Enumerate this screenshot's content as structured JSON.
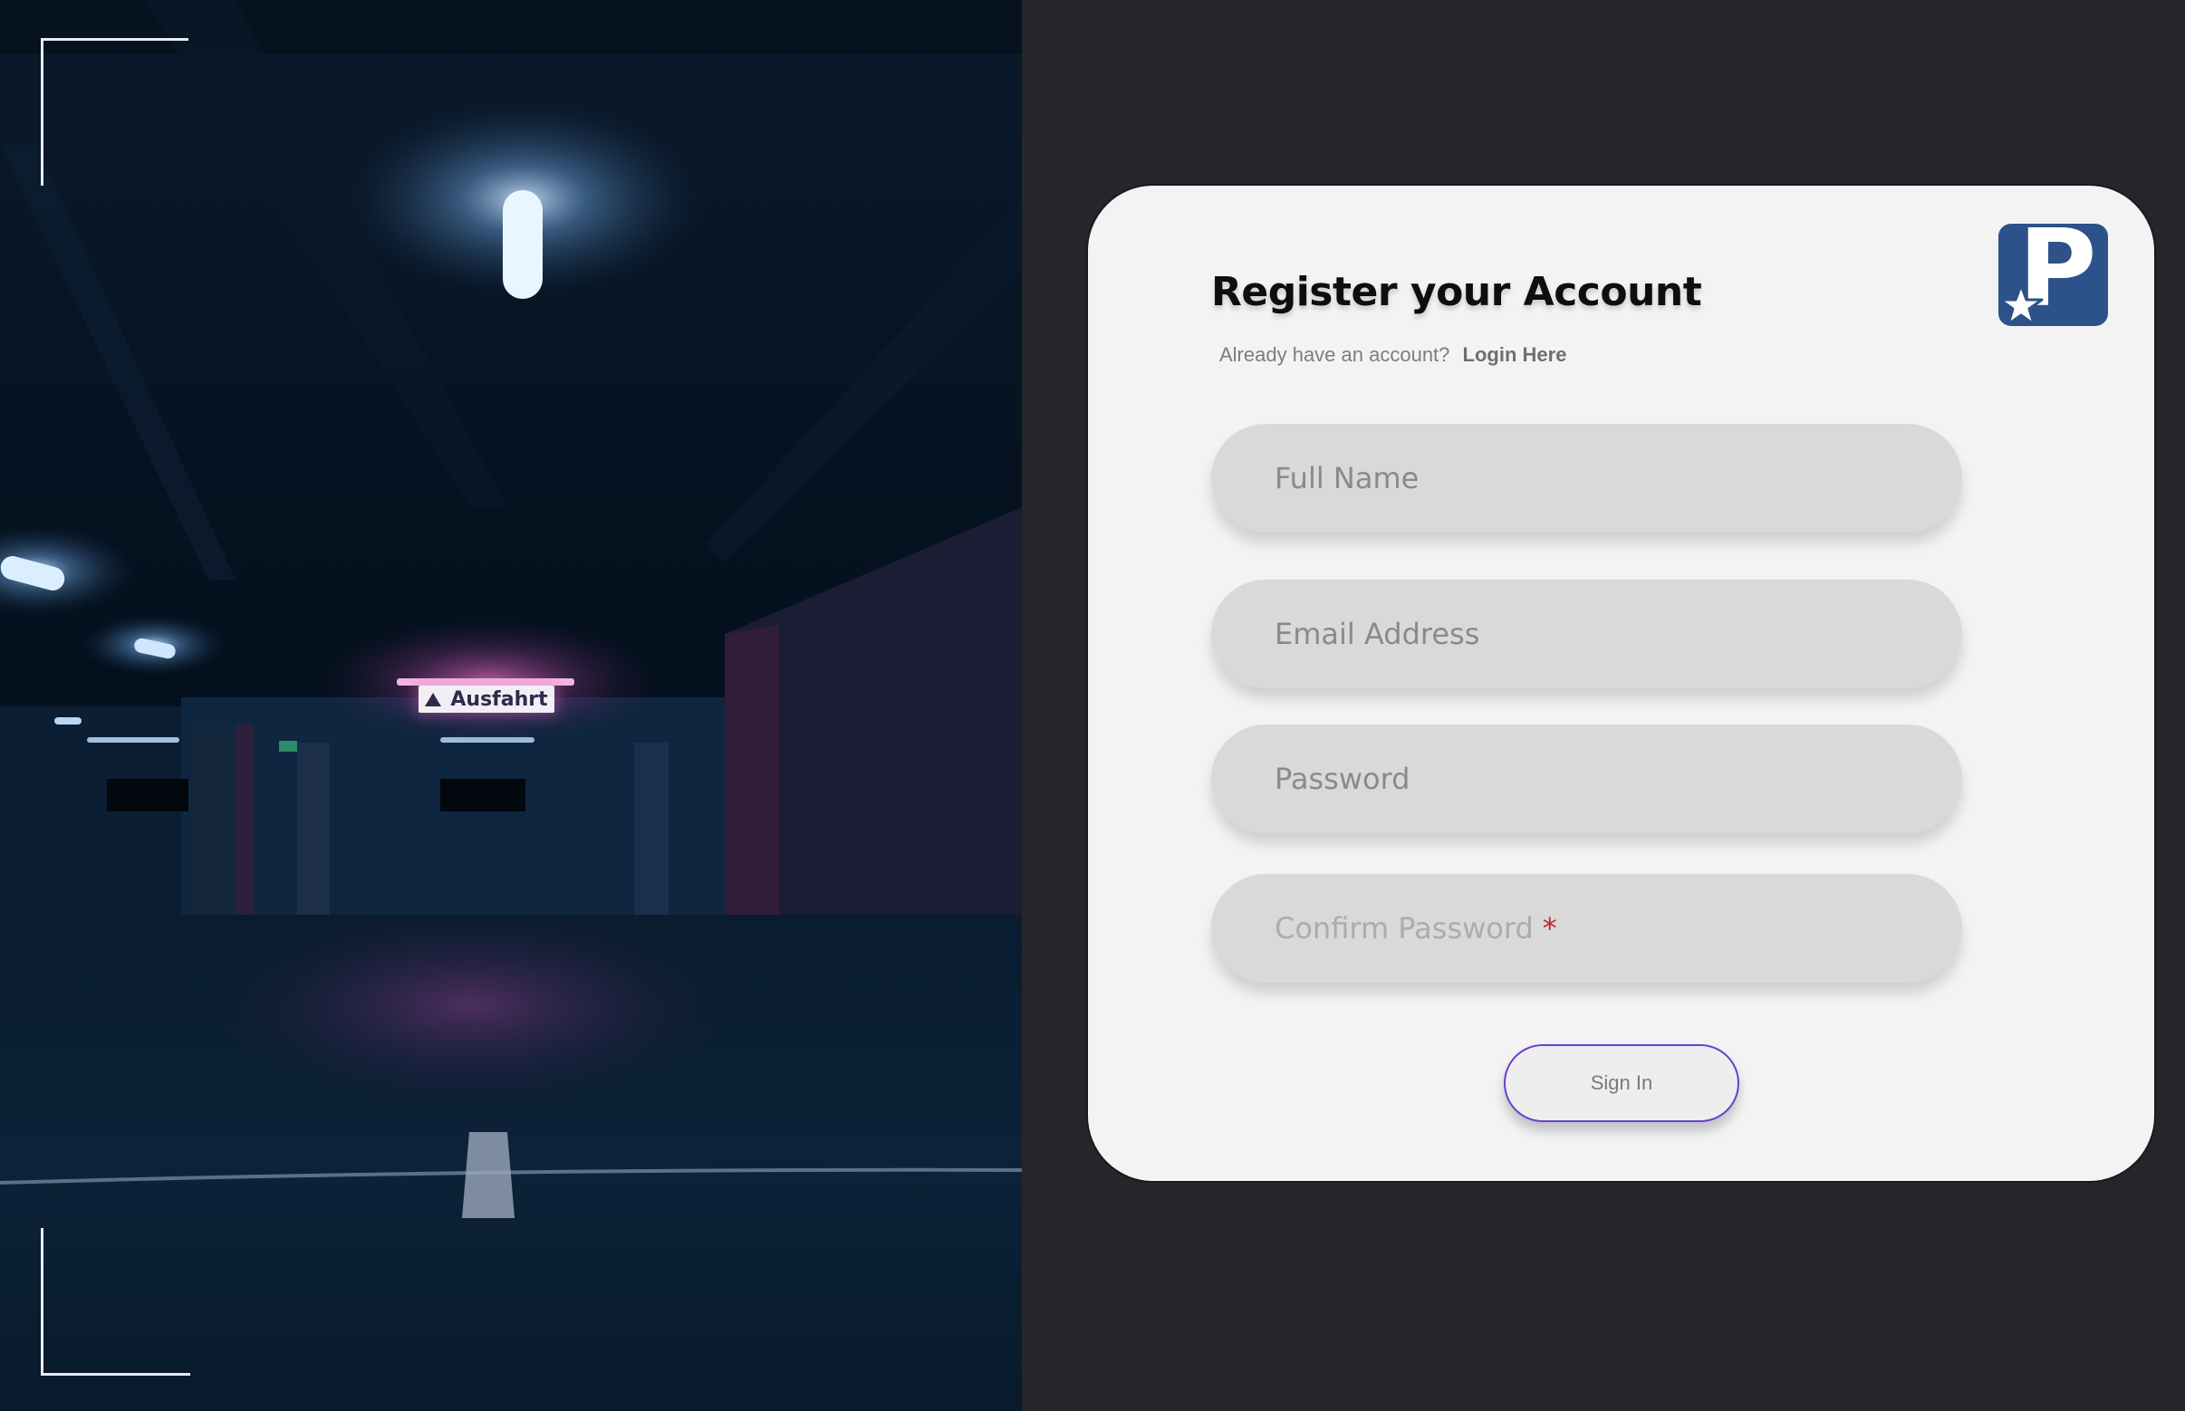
{
  "photo": {
    "sign_text": "Ausfahrt"
  },
  "logo": {
    "letter": "P",
    "icon": "parking-star-icon",
    "color": "#2c5289"
  },
  "form": {
    "title": "Register your Account",
    "subtitle": "Already have an account?",
    "login_link": "Login Here",
    "fields": {
      "full_name": {
        "placeholder": "Full Name"
      },
      "email": {
        "placeholder": "Email Address"
      },
      "password": {
        "placeholder": "Password"
      },
      "confirm_password": {
        "placeholder": "Confirm Password",
        "required_mark": "*"
      }
    },
    "submit_label": "Sign In"
  },
  "colors": {
    "page_background": "#25262b",
    "card_background": "#f3f3f3",
    "field_background": "#d9d9d9",
    "button_border": "#6b3fd0",
    "required": "#c0282d"
  }
}
